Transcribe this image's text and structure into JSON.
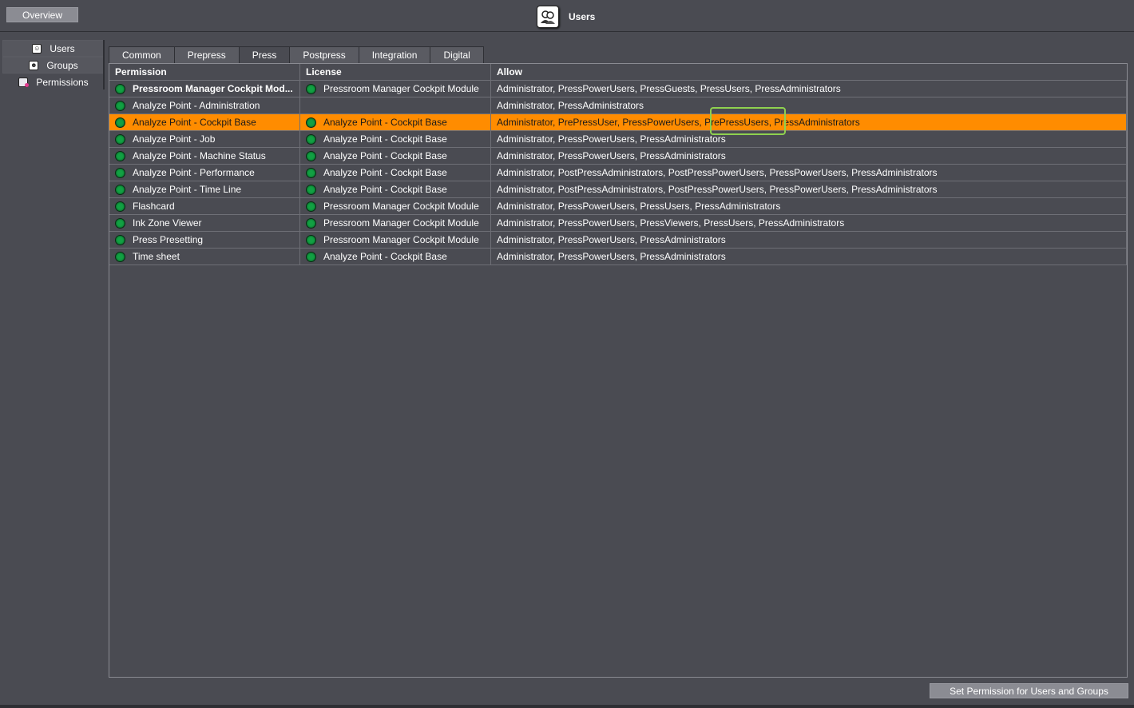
{
  "header": {
    "overview_label": "Overview",
    "title": "Users",
    "title_icon": "users-app-icon"
  },
  "nav": {
    "items": [
      {
        "label": "Users",
        "icon": "user-icon"
      },
      {
        "label": "Groups",
        "icon": "group-icon"
      },
      {
        "label": "Permissions",
        "icon": "permissions-icon"
      }
    ]
  },
  "tabs": [
    "Common",
    "Prepress",
    "Press",
    "Postpress",
    "Integration",
    "Digital"
  ],
  "table": {
    "columns": [
      "Permission",
      "License",
      "Allow"
    ],
    "rows": [
      {
        "permission": "Pressroom Manager Cockpit Mod...",
        "license": "Pressroom Manager Cockpit Module",
        "allow": "Administrator, PressPowerUsers, PressGuests, PressUsers, PressAdministrators"
      },
      {
        "permission": "Analyze Point - Administration",
        "license": "",
        "allow": "Administrator, PressAdministrators"
      },
      {
        "permission": "Analyze Point - Cockpit Base",
        "license": "Analyze Point - Cockpit Base",
        "allow": "Administrator, PrePressUser, PressPowerUsers, PrePressUsers, PressAdministrators"
      },
      {
        "permission": "Analyze Point - Job",
        "license": "Analyze Point - Cockpit Base",
        "allow": "Administrator, PressPowerUsers, PressAdministrators"
      },
      {
        "permission": "Analyze Point - Machine Status",
        "license": "Analyze Point - Cockpit Base",
        "allow": "Administrator, PressPowerUsers, PressAdministrators"
      },
      {
        "permission": "Analyze Point - Performance",
        "license": "Analyze Point - Cockpit Base",
        "allow": "Administrator, PostPressAdministrators, PostPressPowerUsers, PressPowerUsers, PressAdministrators"
      },
      {
        "permission": "Analyze Point - Time Line",
        "license": "Analyze Point - Cockpit Base",
        "allow": "Administrator, PostPressAdministrators, PostPressPowerUsers, PressPowerUsers, PressAdministrators"
      },
      {
        "permission": "Flashcard",
        "license": "Pressroom Manager Cockpit Module",
        "allow": "Administrator, PressPowerUsers, PressUsers, PressAdministrators"
      },
      {
        "permission": "Ink Zone Viewer",
        "license": "Pressroom Manager Cockpit Module",
        "allow": "Administrator, PressPowerUsers, PressViewers, PressUsers, PressAdministrators"
      },
      {
        "permission": "Press Presetting",
        "license": "Pressroom Manager Cockpit Module",
        "allow": "Administrator, PressPowerUsers, PressAdministrators"
      },
      {
        "permission": "Time sheet",
        "license": "Analyze Point - Cockpit Base",
        "allow": "Administrator, PressPowerUsers, PressAdministrators"
      }
    ]
  },
  "footer": {
    "set_permission_label": "Set Permission for Users and Groups"
  },
  "colors": {
    "background": "#4a4b52",
    "selection": "#ff8c00",
    "status_ok": "#12a043",
    "highlight": "#8fd14f"
  }
}
